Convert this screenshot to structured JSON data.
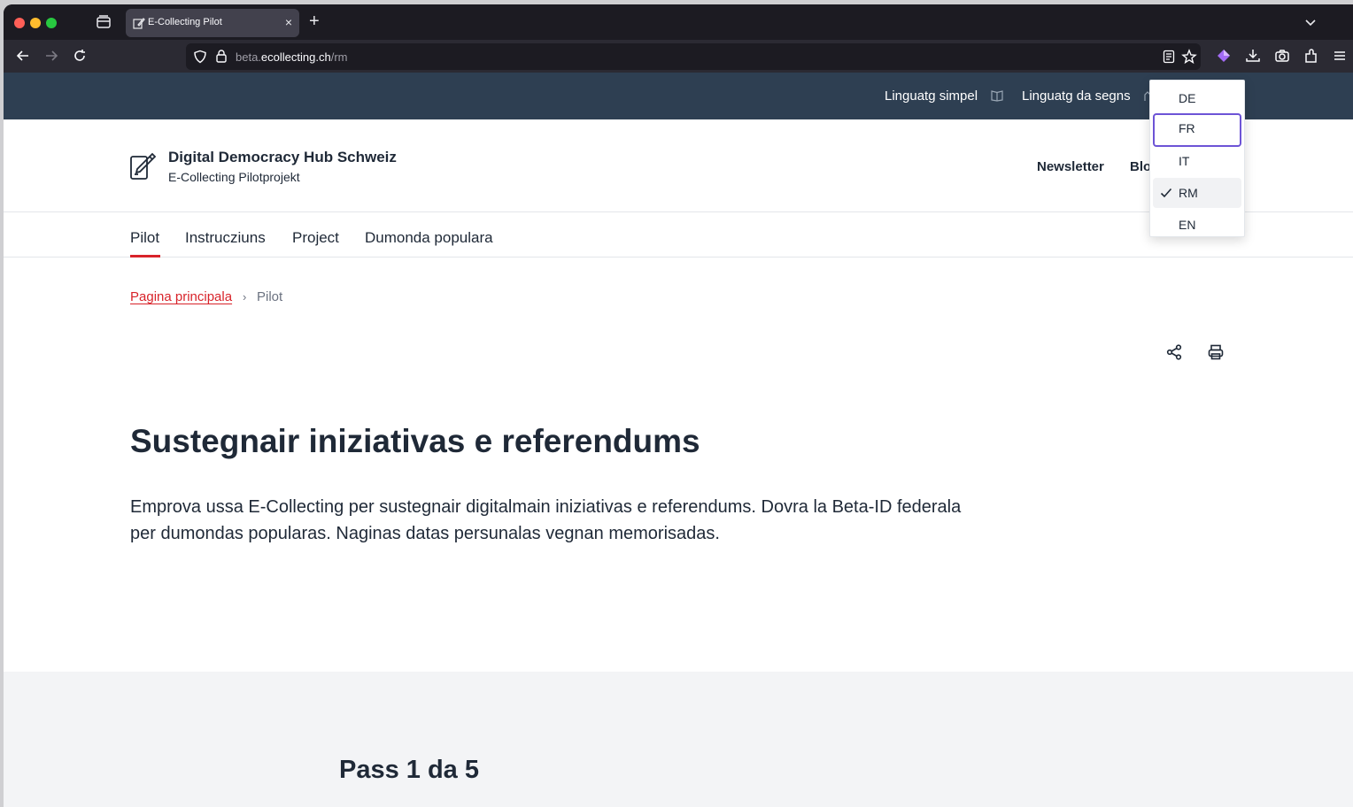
{
  "browser": {
    "tab_title": "E-Collecting Pilot",
    "tab_close": "×",
    "new_tab": "+",
    "url_domain": "beta.",
    "url_host": "ecollecting.ch",
    "url_path": "/rm"
  },
  "topbar": {
    "simple_language": "Linguatg simpel",
    "sign_language": "Linguatg da segns"
  },
  "header": {
    "title": "Digital Democracy Hub Schweiz",
    "subtitle": "E-Collecting Pilotprojekt",
    "newsletter": "Newsletter",
    "blog_partial": "Blo"
  },
  "nav": {
    "items": [
      "Pilot",
      "Instrucziuns",
      "Project",
      "Dumonda populara"
    ],
    "active": "Pilot"
  },
  "breadcrumb": {
    "home": "Pagina principala",
    "separator": "›",
    "current": "Pilot"
  },
  "main": {
    "title": "Sustegnair iniziativas e referendums",
    "lead": "Emprova ussa E-Collecting per sustegnair digitalmain iniziativas e referendums. Dovra la Beta-ID federala per dumondas popularas. Naginas datas persunalas vegnan memorisadas.",
    "step": "Pass 1 da 5"
  },
  "language_menu": {
    "options": [
      "DE",
      "FR",
      "IT",
      "RM",
      "EN"
    ],
    "selected": "RM",
    "focused": "FR"
  },
  "colors": {
    "topbar": "#2e3f52",
    "accent": "#d8232a",
    "focus": "#6d54d6"
  }
}
